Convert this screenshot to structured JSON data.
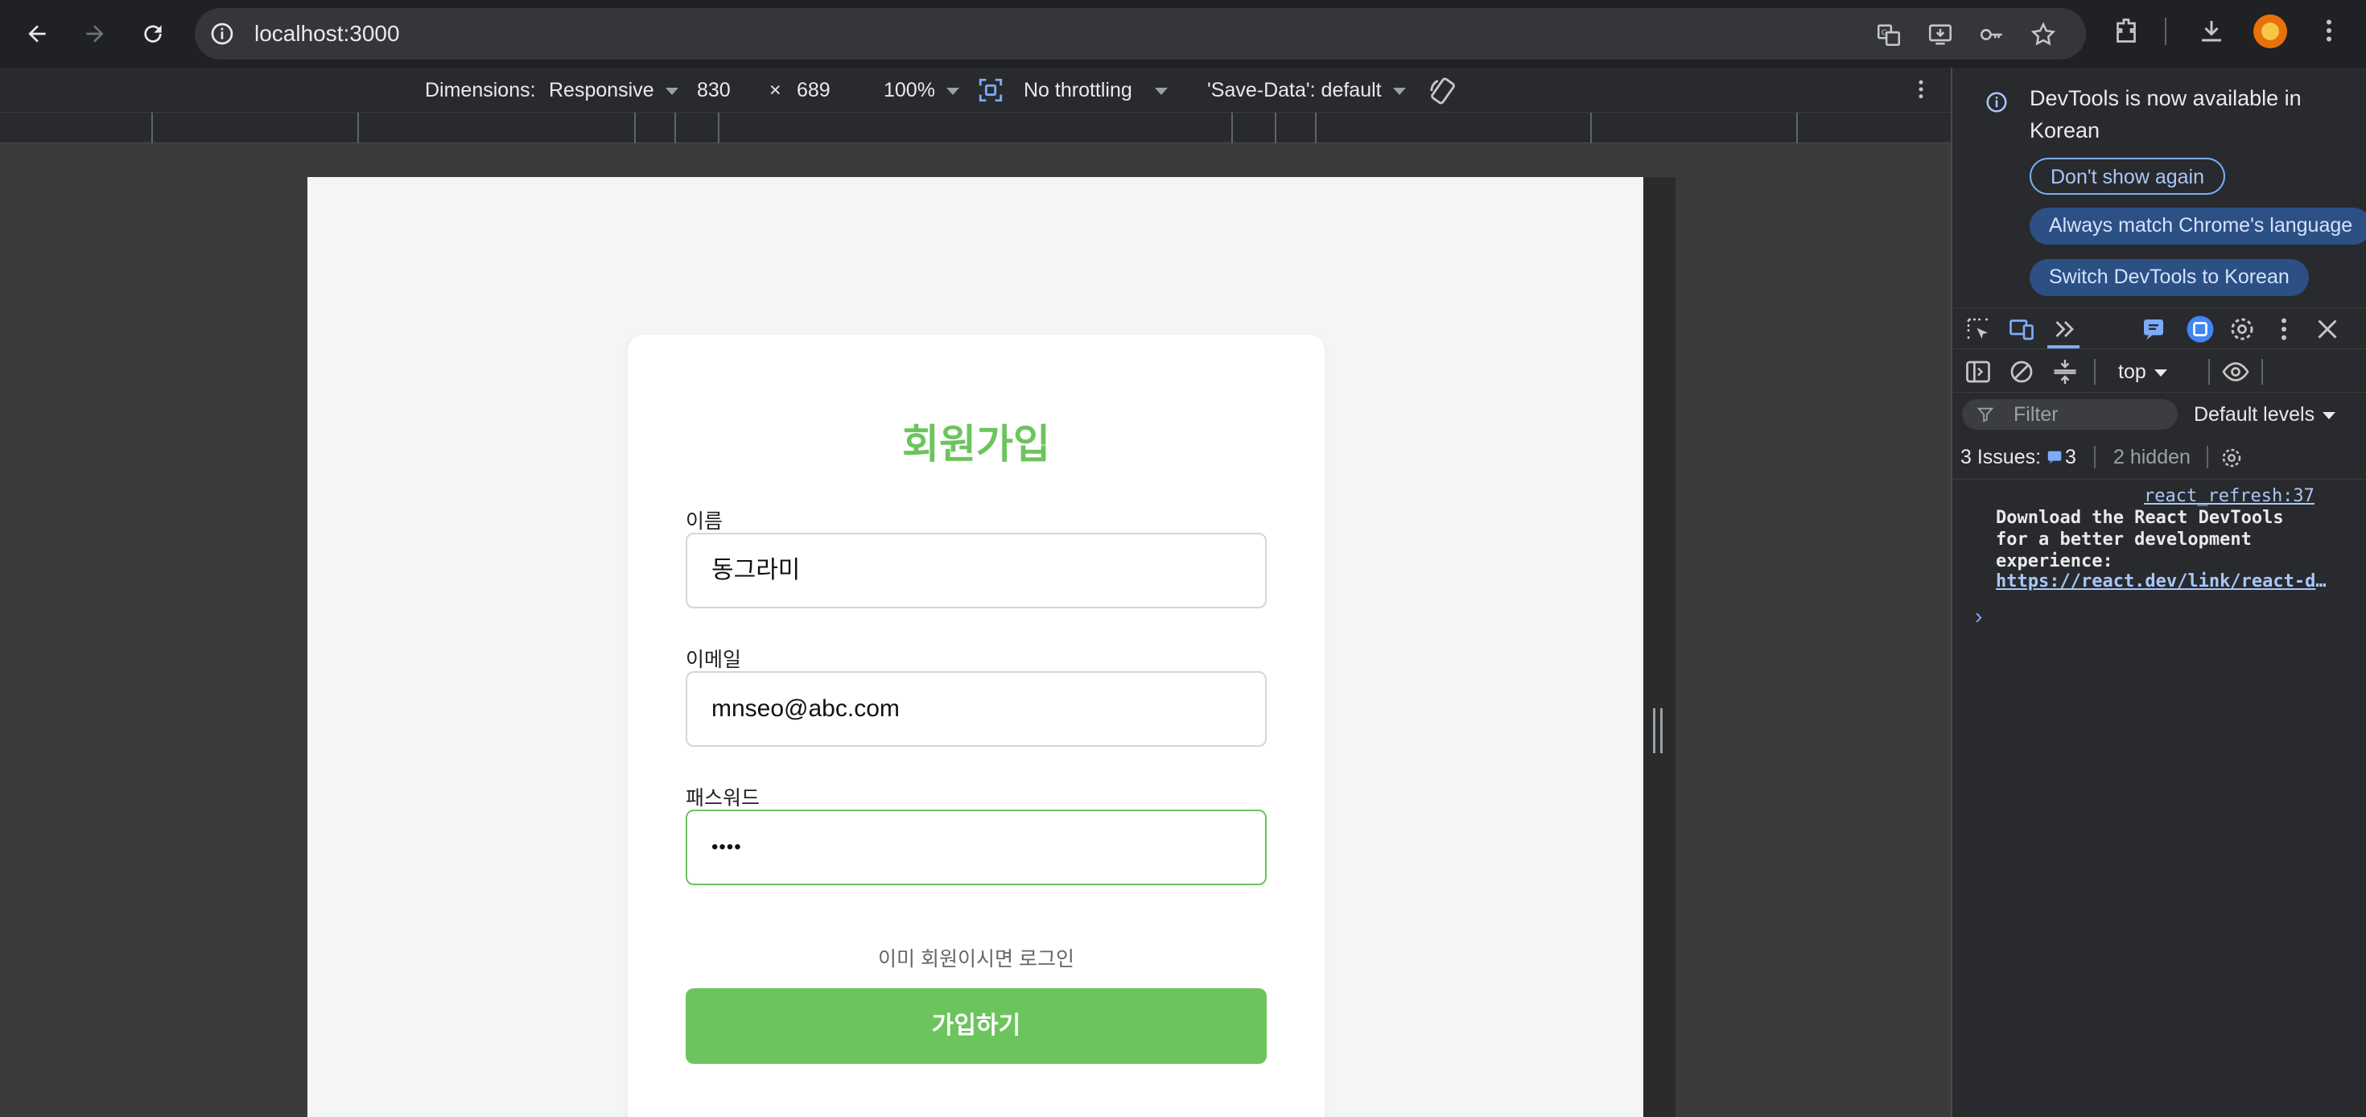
{
  "browser": {
    "url": "localhost:3000",
    "icons": [
      "back-icon",
      "forward-icon",
      "reload-icon",
      "site-info-icon",
      "translate-icon",
      "install-app-icon",
      "password-key-icon",
      "bookmark-star-icon",
      "extensions-icon",
      "download-icon",
      "profile-avatar",
      "more-menu-icon"
    ]
  },
  "device_toolbar": {
    "dimensions_label": "Dimensions:",
    "device": "Responsive",
    "width": "830",
    "times": "×",
    "height": "689",
    "zoom": "100%",
    "throttling": "No throttling",
    "save_data": "'Save-Data': default"
  },
  "page": {
    "title": "회원가입",
    "fields": [
      {
        "label": "이름",
        "value": "동그라미"
      },
      {
        "label": "이메일",
        "value": "mnseo@abc.com"
      },
      {
        "label": "패스워드",
        "value": "••••"
      }
    ],
    "login_link": "이미 회원이시면 로그인",
    "submit_label": "가입하기",
    "accent_color": "#6cc45d"
  },
  "devtools": {
    "info_message": "DevTools is now available in Korean",
    "buttons": {
      "dont_show": "Don't show again",
      "always_match": "Always match Chrome's language",
      "switch": "Switch DevTools to Korean"
    },
    "context": "top",
    "filter_placeholder": "Filter",
    "levels": "Default levels",
    "issues_label": "3 Issues:",
    "issues_count": "3",
    "hidden": "2 hidden",
    "log": {
      "source": "react_refresh:37",
      "message": "Download the React DevTools\nfor a better development\nexperience:",
      "link": "https://react.dev/link/react-devtools"
    },
    "prompt": "›"
  }
}
